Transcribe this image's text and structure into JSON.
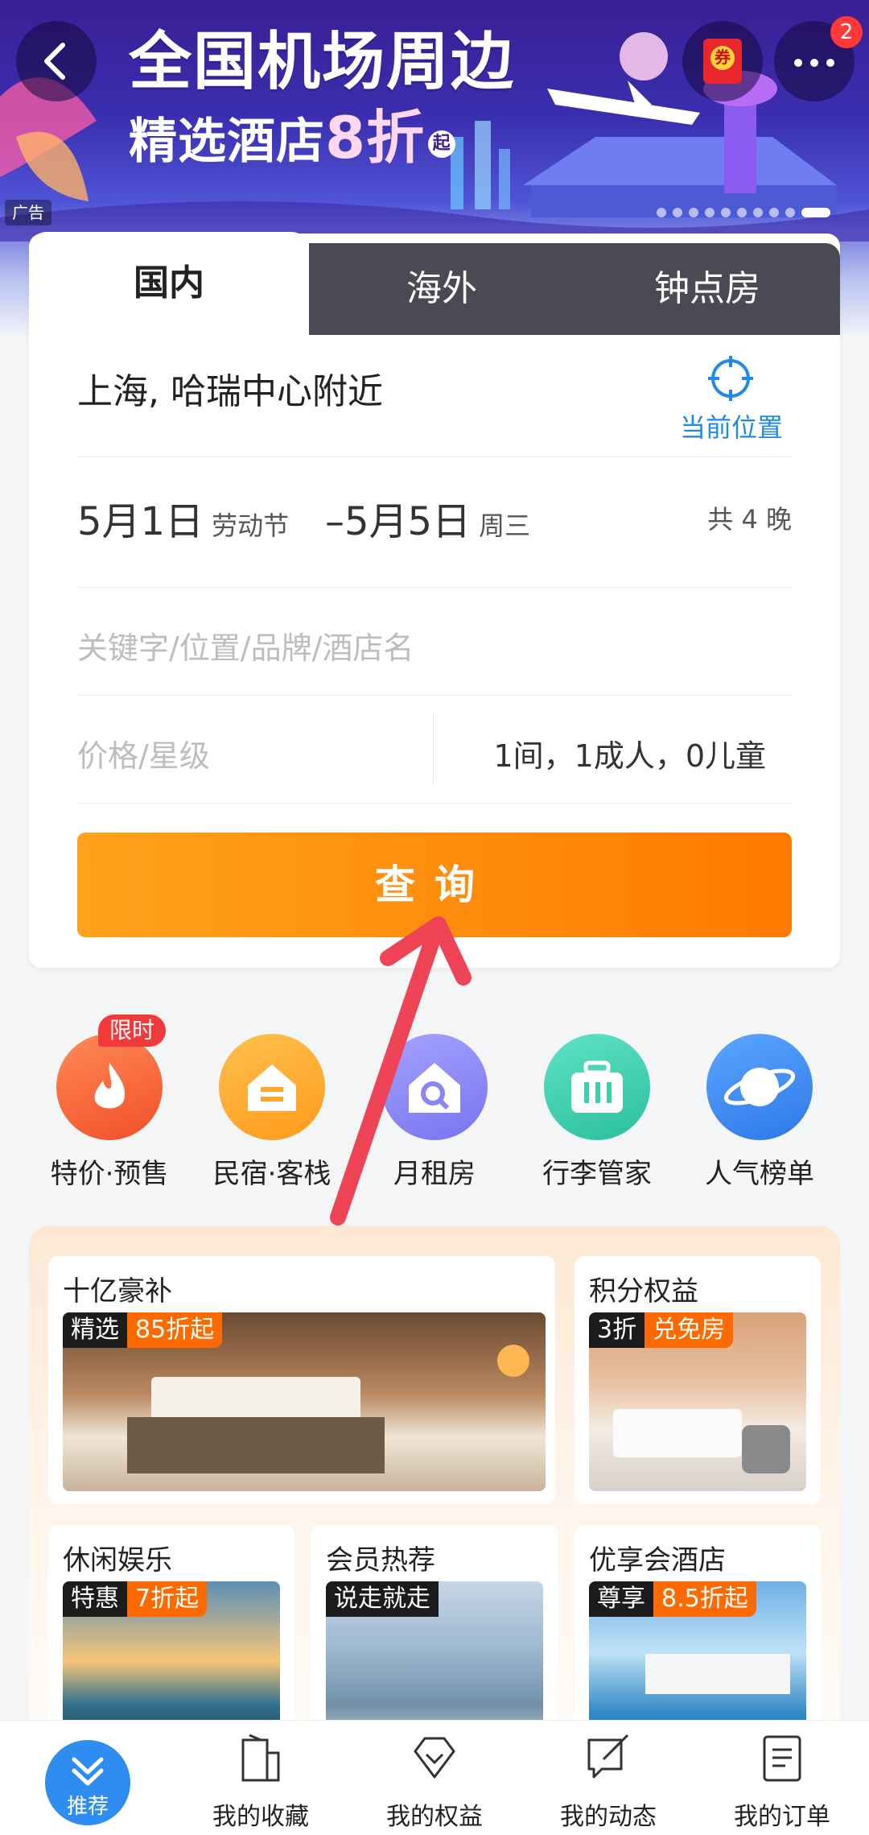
{
  "banner": {
    "title": "全国机场周边",
    "subtitle_main": "精选酒店",
    "subtitle_discount": "8折",
    "subtitle_suffix": "起",
    "ad_label": "广告",
    "coupon_glyph": "券",
    "notification_count": "2"
  },
  "tabs": [
    "国内",
    "海外",
    "钟点房"
  ],
  "search": {
    "location": "上海, 哈瑞中心附近",
    "current_location_label": "当前位置",
    "date_start": "5月1日",
    "date_start_note": "劳动节",
    "date_end": "–5月5日",
    "date_end_note": "周三",
    "nights": "共 4 晚",
    "keyword_placeholder": "关键字/位置/品牌/酒店名",
    "price_placeholder": "价格/星级",
    "guests": "1间，1成人，0儿童",
    "submit_label": "查询"
  },
  "quick_entries": [
    {
      "label": "特价·预售",
      "tag": "限时",
      "color": "#ff6a3d"
    },
    {
      "label": "民宿·客栈",
      "color": "#ffaa2b"
    },
    {
      "label": "月租房",
      "color": "#8b88f6"
    },
    {
      "label": "行李管家",
      "color": "#3fd3b4"
    },
    {
      "label": "人气榜单",
      "color": "#3d8ff2"
    }
  ],
  "promos": [
    {
      "title": "十亿豪补",
      "tag1": "精选",
      "tag2": "85折起"
    },
    {
      "title": "积分权益",
      "tag1": "3折",
      "tag2": "兑免房"
    },
    {
      "title": "休闲娱乐",
      "tag1": "特惠",
      "tag2": "7折起"
    },
    {
      "title": "会员热荐",
      "tag1": "说走就走"
    },
    {
      "title": "优享会酒店",
      "tag1": "尊享",
      "tag2": "8.5折起"
    }
  ],
  "bottom_nav": [
    {
      "label": "推荐",
      "icon": "double-chevron-icon"
    },
    {
      "label": "我的收藏",
      "icon": "building-icon"
    },
    {
      "label": "我的权益",
      "icon": "diamond-icon"
    },
    {
      "label": "我的动态",
      "icon": "edit-message-icon"
    },
    {
      "label": "我的订单",
      "icon": "order-document-icon"
    }
  ],
  "colors": {
    "accent_blue": "#1f8ae8",
    "search_orange": "#ff8a00",
    "annotation_arrow": "#ee4455"
  }
}
